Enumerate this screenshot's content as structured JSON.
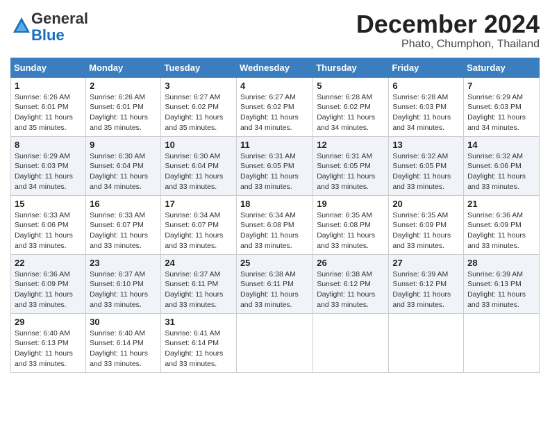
{
  "header": {
    "logo_general": "General",
    "logo_blue": "Blue",
    "month_title": "December 2024",
    "location": "Phato, Chumphon, Thailand"
  },
  "weekdays": [
    "Sunday",
    "Monday",
    "Tuesday",
    "Wednesday",
    "Thursday",
    "Friday",
    "Saturday"
  ],
  "weeks": [
    [
      {
        "day": "1",
        "sunrise": "6:26 AM",
        "sunset": "6:01 PM",
        "daylight": "11 hours and 35 minutes."
      },
      {
        "day": "2",
        "sunrise": "6:26 AM",
        "sunset": "6:01 PM",
        "daylight": "11 hours and 35 minutes."
      },
      {
        "day": "3",
        "sunrise": "6:27 AM",
        "sunset": "6:02 PM",
        "daylight": "11 hours and 35 minutes."
      },
      {
        "day": "4",
        "sunrise": "6:27 AM",
        "sunset": "6:02 PM",
        "daylight": "11 hours and 34 minutes."
      },
      {
        "day": "5",
        "sunrise": "6:28 AM",
        "sunset": "6:02 PM",
        "daylight": "11 hours and 34 minutes."
      },
      {
        "day": "6",
        "sunrise": "6:28 AM",
        "sunset": "6:03 PM",
        "daylight": "11 hours and 34 minutes."
      },
      {
        "day": "7",
        "sunrise": "6:29 AM",
        "sunset": "6:03 PM",
        "daylight": "11 hours and 34 minutes."
      }
    ],
    [
      {
        "day": "8",
        "sunrise": "6:29 AM",
        "sunset": "6:03 PM",
        "daylight": "11 hours and 34 minutes."
      },
      {
        "day": "9",
        "sunrise": "6:30 AM",
        "sunset": "6:04 PM",
        "daylight": "11 hours and 34 minutes."
      },
      {
        "day": "10",
        "sunrise": "6:30 AM",
        "sunset": "6:04 PM",
        "daylight": "11 hours and 33 minutes."
      },
      {
        "day": "11",
        "sunrise": "6:31 AM",
        "sunset": "6:05 PM",
        "daylight": "11 hours and 33 minutes."
      },
      {
        "day": "12",
        "sunrise": "6:31 AM",
        "sunset": "6:05 PM",
        "daylight": "11 hours and 33 minutes."
      },
      {
        "day": "13",
        "sunrise": "6:32 AM",
        "sunset": "6:05 PM",
        "daylight": "11 hours and 33 minutes."
      },
      {
        "day": "14",
        "sunrise": "6:32 AM",
        "sunset": "6:06 PM",
        "daylight": "11 hours and 33 minutes."
      }
    ],
    [
      {
        "day": "15",
        "sunrise": "6:33 AM",
        "sunset": "6:06 PM",
        "daylight": "11 hours and 33 minutes."
      },
      {
        "day": "16",
        "sunrise": "6:33 AM",
        "sunset": "6:07 PM",
        "daylight": "11 hours and 33 minutes."
      },
      {
        "day": "17",
        "sunrise": "6:34 AM",
        "sunset": "6:07 PM",
        "daylight": "11 hours and 33 minutes."
      },
      {
        "day": "18",
        "sunrise": "6:34 AM",
        "sunset": "6:08 PM",
        "daylight": "11 hours and 33 minutes."
      },
      {
        "day": "19",
        "sunrise": "6:35 AM",
        "sunset": "6:08 PM",
        "daylight": "11 hours and 33 minutes."
      },
      {
        "day": "20",
        "sunrise": "6:35 AM",
        "sunset": "6:09 PM",
        "daylight": "11 hours and 33 minutes."
      },
      {
        "day": "21",
        "sunrise": "6:36 AM",
        "sunset": "6:09 PM",
        "daylight": "11 hours and 33 minutes."
      }
    ],
    [
      {
        "day": "22",
        "sunrise": "6:36 AM",
        "sunset": "6:09 PM",
        "daylight": "11 hours and 33 minutes."
      },
      {
        "day": "23",
        "sunrise": "6:37 AM",
        "sunset": "6:10 PM",
        "daylight": "11 hours and 33 minutes."
      },
      {
        "day": "24",
        "sunrise": "6:37 AM",
        "sunset": "6:11 PM",
        "daylight": "11 hours and 33 minutes."
      },
      {
        "day": "25",
        "sunrise": "6:38 AM",
        "sunset": "6:11 PM",
        "daylight": "11 hours and 33 minutes."
      },
      {
        "day": "26",
        "sunrise": "6:38 AM",
        "sunset": "6:12 PM",
        "daylight": "11 hours and 33 minutes."
      },
      {
        "day": "27",
        "sunrise": "6:39 AM",
        "sunset": "6:12 PM",
        "daylight": "11 hours and 33 minutes."
      },
      {
        "day": "28",
        "sunrise": "6:39 AM",
        "sunset": "6:13 PM",
        "daylight": "11 hours and 33 minutes."
      }
    ],
    [
      {
        "day": "29",
        "sunrise": "6:40 AM",
        "sunset": "6:13 PM",
        "daylight": "11 hours and 33 minutes."
      },
      {
        "day": "30",
        "sunrise": "6:40 AM",
        "sunset": "6:14 PM",
        "daylight": "11 hours and 33 minutes."
      },
      {
        "day": "31",
        "sunrise": "6:41 AM",
        "sunset": "6:14 PM",
        "daylight": "11 hours and 33 minutes."
      },
      null,
      null,
      null,
      null
    ]
  ]
}
